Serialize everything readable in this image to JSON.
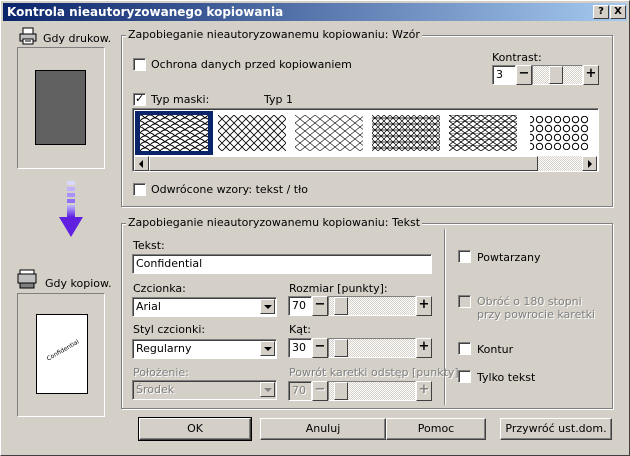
{
  "window": {
    "title": "Kontrola nieautoryzowanego kopiowania",
    "help_label": "?",
    "close_label": "X"
  },
  "left": {
    "print_label": "Gdy drukow.",
    "copy_label": "Gdy kopiow.",
    "copy_sample_text": "Confidential"
  },
  "pattern_group": {
    "title": "Zapobieganie nieautoryzowanemu kopiowaniu: Wzór",
    "protect_label": "Ochrona danych przed kopiowaniem",
    "protect_checked": false,
    "contrast_label": "Kontrast:",
    "contrast_value": "3",
    "contrast_level": 0.45,
    "mask_label": "Typ maski:",
    "mask_checked": true,
    "mask_type": "Typ 1",
    "patterns": [
      "scales",
      "diamond-lattice",
      "fine-lattice",
      "dense-lattice",
      "brick-lattice",
      "circles"
    ],
    "selected_pattern": 0,
    "invert_label": "Odwrócone wzory: tekst / tło",
    "invert_checked": false
  },
  "text_group": {
    "title": "Zapobieganie nieautoryzowanemu kopiowaniu: Tekst",
    "text_label": "Tekst:",
    "text_value": "Confidential",
    "font_label": "Czcionka:",
    "font_value": "Arial",
    "size_label": "Rozmiar [punkty]:",
    "size_value": "70",
    "style_label": "Styl czcionki:",
    "style_value": "Regularny",
    "angle_label": "Kąt:",
    "angle_value": "30",
    "position_label": "Położenie:",
    "position_value": "Środek",
    "spacing_label": "Powrót karetki odstęp [punkty]:",
    "spacing_value": "70",
    "repeat_label": "Powtarzany",
    "rotate_label": "Obróć o 180 stopni przy powrocie karetki",
    "outline_label": "Kontur",
    "text_only_label": "Tylko tekst"
  },
  "buttons": {
    "ok": "OK",
    "cancel": "Anuluj",
    "help": "Pomoc",
    "defaults": "Przywróć ust.dom."
  },
  "stepper": {
    "minus": "−",
    "plus": "+"
  }
}
